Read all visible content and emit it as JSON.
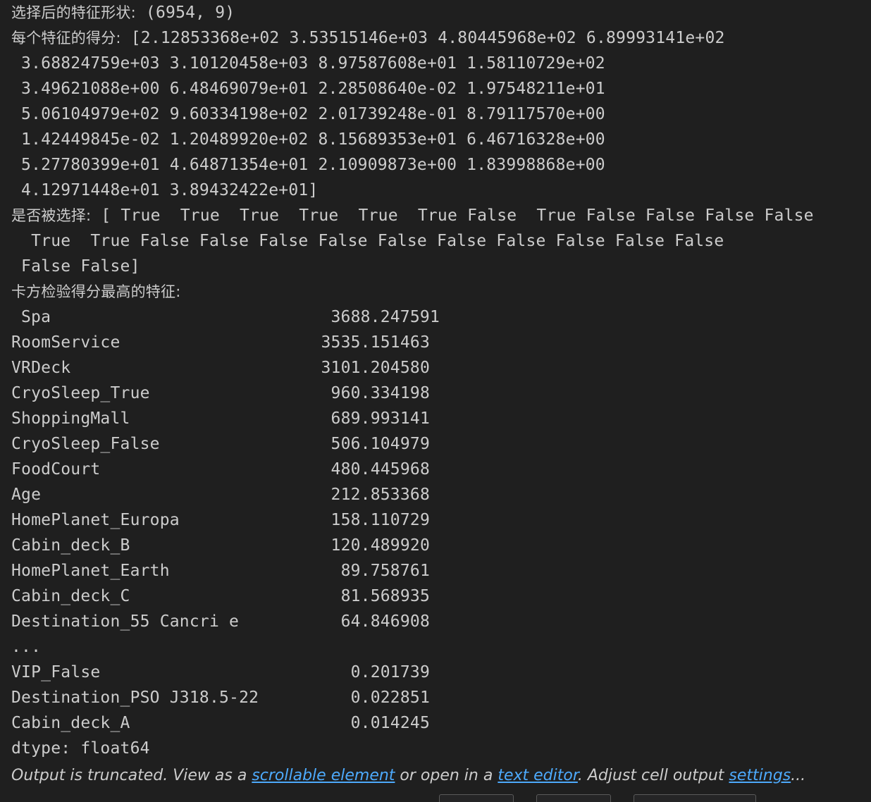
{
  "shape_line": {
    "label": "选择后的特征形状:",
    "value": " (6954, 9)"
  },
  "scores": {
    "label": "每个特征的得分:",
    "first": " [2.12853368e+02 3.53515146e+03 4.80445968e+02 6.89993141e+02",
    "lines": [
      " 3.68824759e+03 3.10120458e+03 8.97587608e+01 1.58110729e+02",
      " 3.49621088e+00 6.48469079e+01 2.28508640e-02 1.97548211e+01",
      " 5.06104979e+02 9.60334198e+02 2.01739248e-01 8.79117570e+00",
      " 1.42449845e-02 1.20489920e+02 8.15689353e+01 6.46716328e+00",
      " 5.27780399e+01 4.64871354e+01 2.10909873e+00 1.83998868e+00",
      " 4.12971448e+01 3.89432422e+01]"
    ]
  },
  "selected": {
    "label": "是否被选择:",
    "first": " [ True  True  True  True  True  True False  True False False False False",
    "lines": [
      "  True  True False False False False False False False False False False",
      " False False]"
    ]
  },
  "top_features": {
    "label": "卡方检验得分最高的特征:",
    "rows": [
      {
        "name": "Spa",
        "value": "3688.247591"
      },
      {
        "name": "RoomService",
        "value": "3535.151463"
      },
      {
        "name": "VRDeck",
        "value": "3101.204580"
      },
      {
        "name": "CryoSleep_True",
        "value": "960.334198"
      },
      {
        "name": "ShoppingMall",
        "value": "689.993141"
      },
      {
        "name": "CryoSleep_False",
        "value": "506.104979"
      },
      {
        "name": "FoodCourt",
        "value": "480.445968"
      },
      {
        "name": "Age",
        "value": "212.853368"
      },
      {
        "name": "HomePlanet_Europa",
        "value": "158.110729"
      },
      {
        "name": "Cabin_deck_B",
        "value": "120.489920"
      },
      {
        "name": "HomePlanet_Earth",
        "value": "89.758761"
      },
      {
        "name": "Cabin_deck_C",
        "value": "81.568935"
      },
      {
        "name": "Destination_55 Cancri e",
        "value": "64.846908"
      }
    ],
    "ellipsis": "...",
    "tail_rows": [
      {
        "name": "VIP_False",
        "value": "0.201739"
      },
      {
        "name": "Destination_PSO J318.5-22",
        "value": "0.022851"
      },
      {
        "name": "Cabin_deck_A",
        "value": "0.014245"
      }
    ],
    "dtype": "dtype: float64"
  },
  "truncation": {
    "prefix": "Output is truncated. View as a ",
    "link1": "scrollable element",
    "middle": " or open in a ",
    "link2": "text editor",
    "middle2": ". Adjust cell output ",
    "link3": "settings",
    "suffix": "..."
  },
  "colors": {
    "background": "#1f1f1f",
    "text": "#cccccc",
    "link": "#4daafc"
  }
}
